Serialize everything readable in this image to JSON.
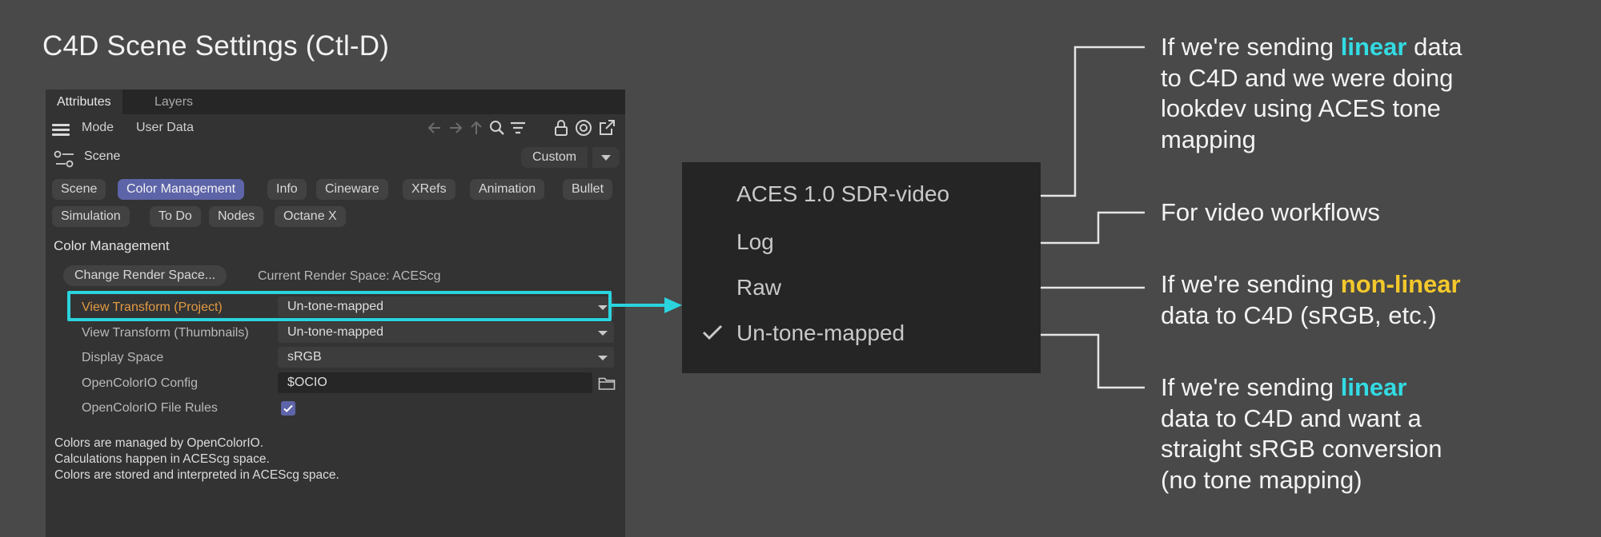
{
  "page": {
    "title": "C4D Scene Settings (Ctl-D)"
  },
  "colors": {
    "background": "#494949",
    "panel": "#333333",
    "accent_cyan": "#2bd3dd",
    "accent_yellow": "#f3c82b",
    "active_tab": "#5d64a8",
    "orange_label": "#e39a44"
  },
  "panel": {
    "tabs": [
      {
        "label": "Attributes",
        "active": true
      },
      {
        "label": "Layers",
        "active": false
      }
    ],
    "menu": {
      "mode": "Mode",
      "user_data": "User Data"
    },
    "toolbar_icons": [
      "arrow-left-icon",
      "arrow-right-icon",
      "arrow-up-icon",
      "search-icon",
      "filter-icon",
      "lock-icon",
      "target-icon",
      "open-external-icon"
    ],
    "scene_row": {
      "label": "Scene",
      "preset": "Custom"
    },
    "subtabs_row1": [
      "Scene",
      "Color Management",
      "Info",
      "Cineware",
      "XRefs",
      "Animation",
      "Bullet"
    ],
    "subtabs_row2": [
      "Simulation",
      "To Do",
      "Nodes",
      "Octane X"
    ],
    "active_subtab": "Color Management",
    "section_title": "Color Management",
    "change_render_space_button": "Change Render Space...",
    "current_render_space": "Current Render Space: ACEScg",
    "params": [
      {
        "label": "View Transform (Project)",
        "value": "Un-tone-mapped",
        "kind": "dropdown"
      },
      {
        "label": "View Transform (Thumbnails)",
        "value": "Un-tone-mapped",
        "kind": "dropdown"
      },
      {
        "label": "Display Space",
        "value": "sRGB",
        "kind": "dropdown"
      },
      {
        "label": "OpenColorIO Config",
        "value": "$OCIO",
        "kind": "path"
      },
      {
        "label": "OpenColorIO File Rules",
        "value": "checked",
        "kind": "checkbox"
      }
    ],
    "notes": [
      "Colors are managed by OpenColorIO.",
      "Calculations happen in ACEScg space.",
      "Colors are stored and interpreted in ACEScg space."
    ]
  },
  "popup": {
    "options": [
      "ACES 1.0 SDR-video",
      "Log",
      "Raw",
      "Un-tone-mapped"
    ],
    "checked_option": "Un-tone-mapped"
  },
  "annotations": {
    "aces": {
      "pre": "If we're sending ",
      "highlight": "linear",
      "post1": " data",
      "lines": [
        "to C4D and we were doing",
        "lookdev using ACES tone",
        "mapping"
      ]
    },
    "log": {
      "text": "For video workflows"
    },
    "raw": {
      "pre": "If we're sending ",
      "highlight": "non-linear",
      "line2": "data to C4D (sRGB, etc.)"
    },
    "untone": {
      "pre": "If we're sending ",
      "highlight": "linear",
      "lines": [
        "data to C4D and want a",
        "straight sRGB conversion",
        "(no tone mapping)"
      ]
    }
  }
}
